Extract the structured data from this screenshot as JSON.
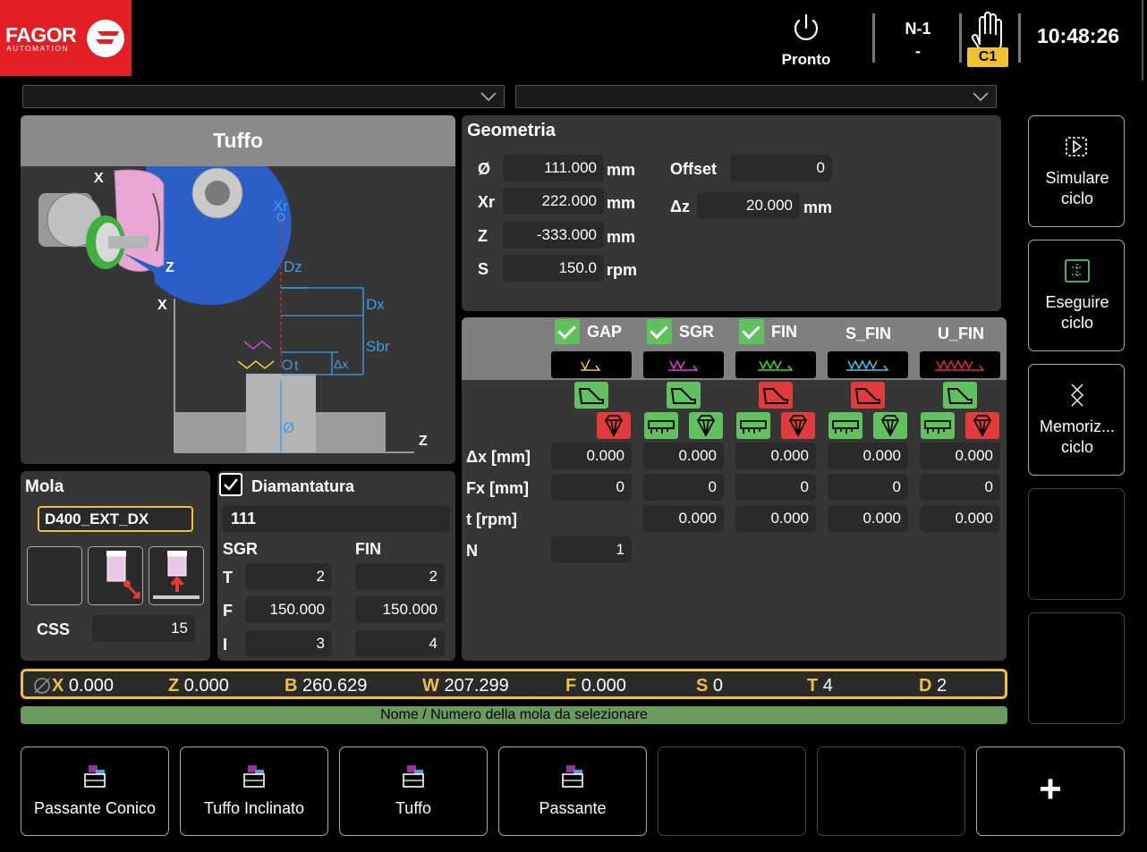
{
  "header": {
    "brand": "FAGOR",
    "brand_sub": "AUTOMATION",
    "power_label": "Pronto",
    "n_label": "N-1",
    "n_value": "-",
    "channel": "C1",
    "time": "10:48:26"
  },
  "cycle": {
    "title": "Tuffo",
    "diagram_labels": {
      "xr": "Xr",
      "dz": "Dz",
      "dx": "Dx",
      "sbr": "Sbr",
      "t": "t",
      "delta_x": "Δx",
      "diameter": "Ø",
      "z": "Z",
      "x": "X"
    }
  },
  "geometry": {
    "title": "Geometria",
    "rows": [
      {
        "label": "Ø",
        "value": "111.000",
        "unit": "mm"
      },
      {
        "label": "Xr",
        "value": "222.000",
        "unit": "mm"
      },
      {
        "label": "Z",
        "value": "-333.000",
        "unit": "mm"
      },
      {
        "label": "S",
        "value": "150.0",
        "unit": "rpm"
      }
    ],
    "offset_label": "Offset",
    "offset_value": "0",
    "dz_label": "Δz",
    "dz_value": "20.000",
    "dz_unit": "mm"
  },
  "phases": {
    "columns": [
      {
        "name": "GAP",
        "checked": true,
        "sym_color": "#f0d020"
      },
      {
        "name": "SGR",
        "checked": true,
        "sym_color": "#e040e0"
      },
      {
        "name": "FIN",
        "checked": true,
        "sym_color": "#30e030"
      },
      {
        "name": "S_FIN",
        "checked": false,
        "sym_color": "#40c8f0"
      },
      {
        "name": "U_FIN",
        "checked": false,
        "sym_color": "#e03030"
      }
    ],
    "row_labels": {
      "dx": "Δx [mm]",
      "fx": "Fx [mm]",
      "t": "t [rpm]",
      "n": "N"
    },
    "dx": [
      "0.000",
      "0.000",
      "0.000",
      "0.000",
      "0.000"
    ],
    "fx": [
      "0",
      "0",
      "0",
      "0",
      "0"
    ],
    "t": [
      "0.000",
      "0.000",
      "0.000",
      "0.000"
    ],
    "n": "1"
  },
  "mola": {
    "title": "Mola",
    "name": "D400_EXT_DX",
    "css_label": "CSS",
    "css_value": "15"
  },
  "dressing": {
    "title": "Diamantatura",
    "checked": true,
    "value": "111",
    "col1": "SGR",
    "col2": "FIN",
    "rows": [
      {
        "label": "T",
        "sgr": "2",
        "fin": "2"
      },
      {
        "label": "F",
        "sgr": "150.000",
        "fin": "150.000"
      },
      {
        "label": "I",
        "sgr": "3",
        "fin": "4"
      }
    ]
  },
  "axes": [
    {
      "name": "X",
      "value": "0.000"
    },
    {
      "name": "Z",
      "value": "0.000"
    },
    {
      "name": "B",
      "value": "260.629"
    },
    {
      "name": "W",
      "value": "207.299"
    },
    {
      "name": "F",
      "value": "0.000"
    },
    {
      "name": "S",
      "value": "0"
    },
    {
      "name": "T",
      "value": "4"
    },
    {
      "name": "D",
      "value": "2"
    }
  ],
  "message": "Nome / Numero della mola da selezionare",
  "side_buttons": [
    {
      "label": "Simulare ciclo"
    },
    {
      "label": "Eseguire ciclo"
    },
    {
      "label": "Memoriz... ciclo"
    }
  ],
  "bottom_buttons": [
    {
      "label": "Passante Conico"
    },
    {
      "label": "Tuffo Inclinato"
    },
    {
      "label": "Tuffo"
    },
    {
      "label": "Passante"
    },
    {
      "label": "+"
    }
  ],
  "colors": {
    "brand_red": "#e31e24",
    "accent_yellow": "#f0c040",
    "ok_green": "#5fc25f",
    "alert_red": "#e33b3b",
    "message_green": "#6b9a5e"
  }
}
